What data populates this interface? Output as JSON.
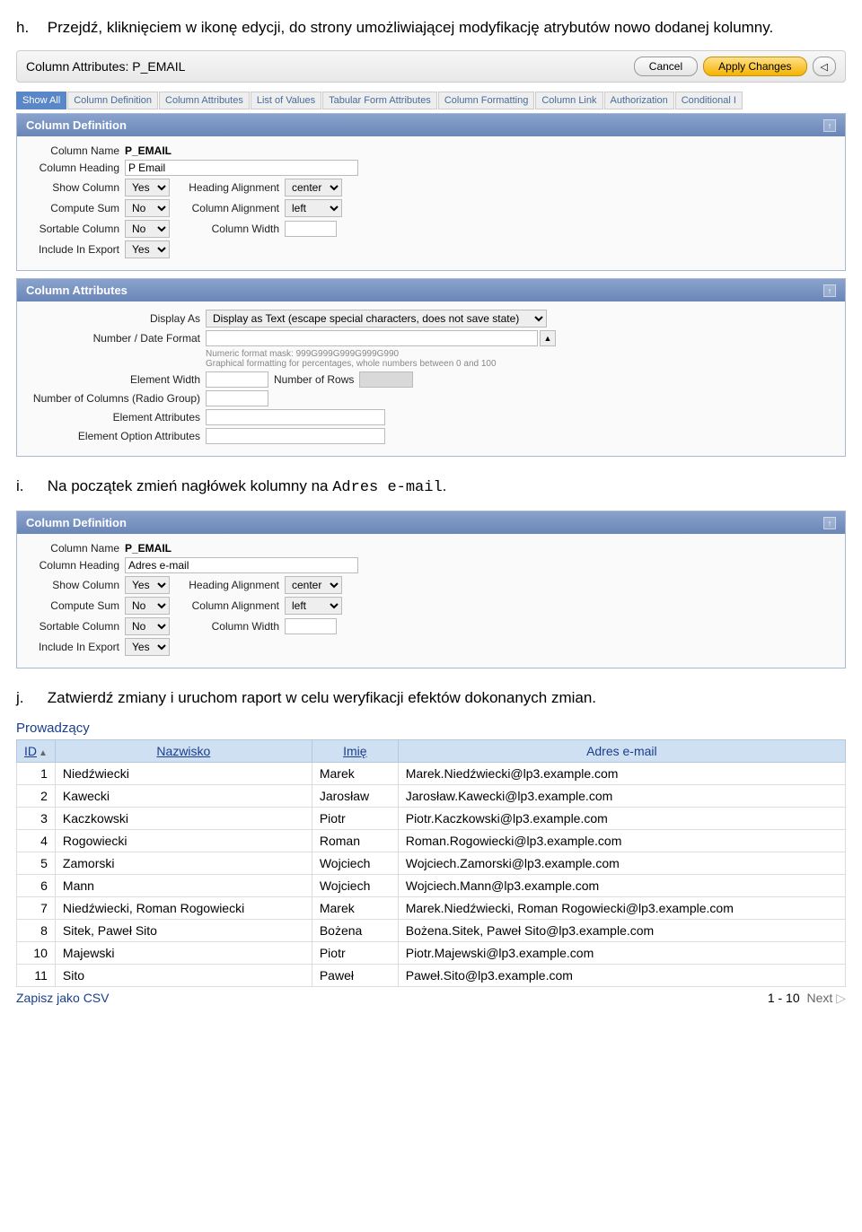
{
  "step_h": {
    "marker": "h.",
    "text": "Przejdź, kliknięciem w ikonę edycji, do strony umożliwiającej modyfikację atrybutów nowo dodanej kolumny."
  },
  "toolbar": {
    "title": "Column Attributes: P_EMAIL",
    "cancel": "Cancel",
    "apply": "Apply Changes"
  },
  "tabs": [
    "Show All",
    "Column Definition",
    "Column Attributes",
    "List of Values",
    "Tabular Form Attributes",
    "Column Formatting",
    "Column Link",
    "Authorization",
    "Conditional I"
  ],
  "defn1": {
    "title": "Column Definition",
    "labels": {
      "name": "Column Name",
      "heading": "Column Heading",
      "show": "Show Column",
      "sum": "Compute Sum",
      "sort": "Sortable Column",
      "export": "Include In Export",
      "halign": "Heading Alignment",
      "calign": "Column Alignment",
      "cwidth": "Column Width"
    },
    "name": "P_EMAIL",
    "heading": "P Email",
    "show": "Yes",
    "sum": "No",
    "sort": "No",
    "export": "Yes",
    "halign": "center",
    "calign": "left",
    "cwidth": ""
  },
  "attr": {
    "title": "Column Attributes",
    "labels": {
      "display": "Display As",
      "nformat": "Number / Date Format",
      "ewidth": "Element Width",
      "nrows": "Number of Rows",
      "ncols": "Number of Columns (Radio Group)",
      "eattr": "Element Attributes",
      "eoattr": "Element Option Attributes"
    },
    "display": "Display as Text (escape special characters, does not save state)",
    "nformat": "",
    "hint1": "Numeric format mask: 999G999G999G999G990",
    "hint2": "Graphical formatting for percentages, whole numbers between 0 and 100",
    "ewidth": "",
    "nrows": "",
    "ncols": "",
    "eattr": "",
    "eoattr": ""
  },
  "step_i": {
    "marker": "i.",
    "pre": "Na początek zmień nagłówek kolumny na ",
    "code": "Adres e-mail",
    "post": "."
  },
  "defn2": {
    "title": "Column Definition",
    "name": "P_EMAIL",
    "heading": "Adres e-mail",
    "show": "Yes",
    "sum": "No",
    "sort": "No",
    "export": "Yes",
    "halign": "center",
    "calign": "left",
    "cwidth": ""
  },
  "step_j": {
    "marker": "j.",
    "text": "Zatwierdź zmiany i uruchom raport w celu weryfikacji efektów dokonanych zmian."
  },
  "report": {
    "title": "Prowadzący",
    "headers": {
      "id": "ID",
      "naz": "Nazwisko",
      "imie": "Imię",
      "email": "Adres e-mail"
    },
    "rows": [
      {
        "id": "1",
        "naz": "Niedźwiecki",
        "imie": "Marek",
        "email": "Marek.Niedźwiecki@lp3.example.com"
      },
      {
        "id": "2",
        "naz": "Kawecki",
        "imie": "Jarosław",
        "email": "Jarosław.Kawecki@lp3.example.com"
      },
      {
        "id": "3",
        "naz": "Kaczkowski",
        "imie": "Piotr",
        "email": "Piotr.Kaczkowski@lp3.example.com"
      },
      {
        "id": "4",
        "naz": "Rogowiecki",
        "imie": "Roman",
        "email": "Roman.Rogowiecki@lp3.example.com"
      },
      {
        "id": "5",
        "naz": "Zamorski",
        "imie": "Wojciech",
        "email": "Wojciech.Zamorski@lp3.example.com"
      },
      {
        "id": "6",
        "naz": "Mann",
        "imie": "Wojciech",
        "email": "Wojciech.Mann@lp3.example.com"
      },
      {
        "id": "7",
        "naz": "Niedźwiecki, Roman Rogowiecki",
        "imie": "Marek",
        "email": "Marek.Niedźwiecki, Roman Rogowiecki@lp3.example.com"
      },
      {
        "id": "8",
        "naz": "Sitek, Paweł Sito",
        "imie": "Bożena",
        "email": "Bożena.Sitek, Paweł Sito@lp3.example.com"
      },
      {
        "id": "10",
        "naz": "Majewski",
        "imie": "Piotr",
        "email": "Piotr.Majewski@lp3.example.com"
      },
      {
        "id": "11",
        "naz": "Sito",
        "imie": "Paweł",
        "email": "Paweł.Sito@lp3.example.com"
      }
    ],
    "csv": "Zapisz jako CSV",
    "range": "1 - 10",
    "next": "Next"
  }
}
